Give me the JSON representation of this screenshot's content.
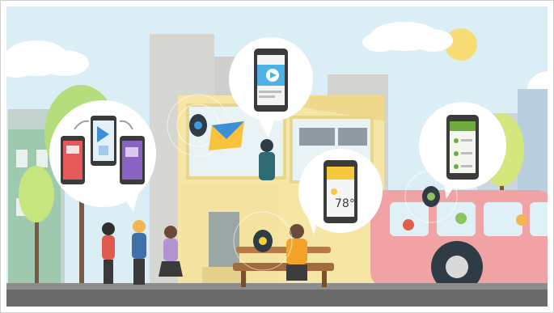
{
  "scene": {
    "weather_card": {
      "temperature": "78°"
    },
    "colors": {
      "sky": "#d9ecf5",
      "road": "#6a6a6a",
      "bus": "#f0a2a4",
      "building": "#f5e6a6",
      "tree": "#a9d46f",
      "beacon": "#2f3b45"
    },
    "icons": [
      "sun-icon",
      "cloud-icon",
      "phone-icon",
      "beacon-icon",
      "envelope-icon",
      "play-icon",
      "bus-icon",
      "tree-icon",
      "bench-icon"
    ]
  }
}
